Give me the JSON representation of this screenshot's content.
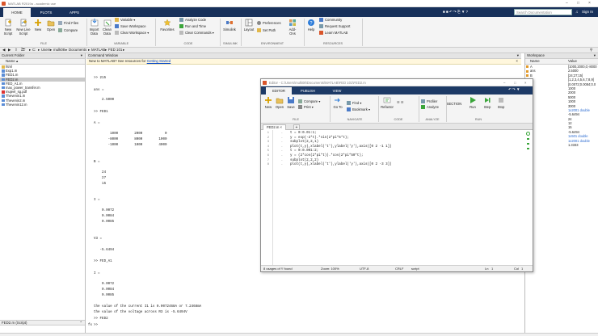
{
  "window": {
    "title": "MATLAB R2019a - academic use"
  },
  "tabs": [
    "HOME",
    "PLOTS",
    "APPS"
  ],
  "search_placeholder": "Search Documentation",
  "sign_in": "Sign In",
  "toolstrip": {
    "file": {
      "new_script": "New Script",
      "new_live_script": "New Live Script",
      "new": "New",
      "open": "Open",
      "find_files": "Find Files",
      "compare": "Compare",
      "section": "FILE"
    },
    "variable": {
      "import_data": "Import Data",
      "clean_data": "Clean Data",
      "new_variable": "Variable",
      "save_workspace": "Save Workspace",
      "clear_workspace": "Clear Workspace",
      "section": "VARIABLE"
    },
    "code": {
      "favorites": "Favorites",
      "analyze_code": "Analyze Code",
      "run_and_time": "Run and Time",
      "clear_commands": "Clear Commands",
      "section": "CODE"
    },
    "simulink": {
      "simulink": "Simulink",
      "section": "SIMULINK"
    },
    "environment": {
      "layout": "Layout",
      "preferences": "Preferences",
      "set_path": "Set Path",
      "addons": "Add-Ons",
      "section": "ENVIRONMENT"
    },
    "resources": {
      "help": "Help",
      "community": "Community",
      "request_support": "Request Support",
      "learn_matlab": "Learn MATLAB",
      "section": "RESOURCES"
    }
  },
  "address_path": [
    "C:",
    "Users",
    "mulk08",
    "Documents",
    "MATLAB",
    "FED 101"
  ],
  "current_folder": {
    "title": "Current Folder",
    "column": "Name",
    "items": [
      {
        "name": "html"
      },
      {
        "name": "Exp1.m"
      },
      {
        "name": "FED1.m"
      },
      {
        "name": "FED2.m",
        "selected": true
      },
      {
        "name": "FED_A1.m"
      },
      {
        "name": "max_power_transfer.m"
      },
      {
        "name": "mujeel_sg.pdf"
      },
      {
        "name": "Thevenin1.m"
      },
      {
        "name": "Thevenin2.m"
      },
      {
        "name": "Thevenin12.m"
      }
    ],
    "details": "FED2.m (Script)"
  },
  "command_window": {
    "title": "Command Window",
    "banner_text": "New to MATLAB? See resources for ",
    "banner_link": "Getting Started",
    "lines": [
      ">> 215",
      "ans =",
      "    2.5000",
      ">> FED1",
      "A =",
      "        1000        2000           0",
      "       -8000        8000        1000",
      "       -1000        1000        4000",
      "B =",
      "    24",
      "    27",
      "    15",
      "I =",
      "    0.0072",
      "    0.0084",
      "    0.0085",
      "V3 =",
      "   -5.6494",
      ">> FED_A1",
      "I =",
      "    0.0072",
      "    0.0084",
      "    0.0085",
      "the value of the current I1 is 0.0072468A or 7.2468mA",
      "the value of the voltage across R3 is -5.6494V",
      ">> FED2",
      ">>"
    ]
  },
  "workspace": {
    "title": "Workspace",
    "col_name": "Name",
    "col_value": "Value",
    "rows": [
      {
        "name": "A",
        "value": "[1000,2000,0;-8000"
      },
      {
        "name": "ans",
        "value": "2.5000"
      },
      {
        "name": "B",
        "value": "[24;27;15]"
      },
      {
        "name": "",
        "value": "[1,2,3,4,5,6,7,8,9]"
      },
      {
        "name": "",
        "value": "[0.0072;0.0084;0.0"
      },
      {
        "name": "",
        "value": "1000"
      },
      {
        "name": "",
        "value": "2000"
      },
      {
        "name": "",
        "value": "5000"
      },
      {
        "name": "",
        "value": "1000"
      },
      {
        "name": "",
        "value": "3000"
      },
      {
        "name": "",
        "value": "1x2001 double"
      },
      {
        "name": "",
        "value": "-5.6494"
      },
      {
        "name": "",
        "value": "24"
      },
      {
        "name": "",
        "value": "12"
      },
      {
        "name": "",
        "value": "15"
      },
      {
        "name": "",
        "value": "-5.6494"
      },
      {
        "name": "",
        "value": "1x501 double"
      },
      {
        "name": "",
        "value": "1x2001 double"
      },
      {
        "name": "",
        "value": "1.3333"
      }
    ]
  },
  "editor": {
    "title": "Editor - C:\\Users\\mulk08\\Documents\\MATLAB\\FED 101\\FED2.m",
    "tabs": [
      "EDITOR",
      "PUBLISH",
      "VIEW"
    ],
    "strip": {
      "new": "New",
      "open": "Open",
      "save": "Save",
      "compare": "Compare",
      "print": "Print",
      "go_to": "Go To",
      "find": "Find",
      "bookmark": "Bookmark",
      "refactor": "Refactor",
      "profiler": "Profiler",
      "analyze": "Analyze",
      "section": "SECTION",
      "run": "Run",
      "step": "Step",
      "stop": "Stop",
      "sections": [
        "FILE",
        "NAVIGATE",
        "CODE",
        "ANALYZE",
        "RUN"
      ]
    },
    "file_tab": "FED2.m",
    "code_lines": [
      "t = 0:0.01:1;",
      "y = exp(-2*t).*sin(2*pi*5*t);",
      "subplot(2,2,1)",
      "plot(t,y),xlabel('t'),ylabel('y'),axis([0 2 -1 1])",
      "t = 0:0.001:2;",
      "y = (2*cos(2*pi*t)).*cos(2*pi*50*t);",
      "subplot(2,2,2)",
      "plot(t,y),xlabel('t'),ylabel('y'),axis([0 2 -3 3])"
    ],
    "status": {
      "usages": "8 usages of 't' found",
      "zoom": "Zoom: 100%",
      "encoding": "UTF-8",
      "eol": "CRLF",
      "type": "script",
      "ln_label": "Ln",
      "ln": "1",
      "col_label": "Col",
      "col": "1"
    }
  },
  "colors": {
    "navy": "#17305a",
    "accent_green": "#3aa53a",
    "selected_file": "#c9c9c9"
  }
}
